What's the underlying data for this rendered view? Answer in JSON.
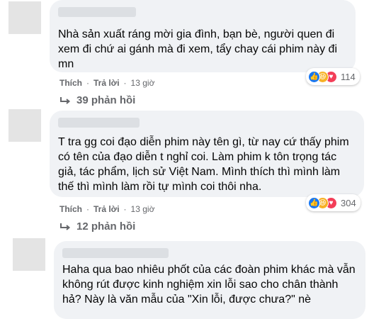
{
  "comments": [
    {
      "text": "Nhà sản xuất ráng mời gia đình, bạn bè, người quen đi xem đi chứ ai gánh mà đi xem, tẩy chay cái phim này đi mn",
      "like_label": "Thích",
      "reply_label": "Trả lời",
      "time": "13 giờ",
      "reaction_count": "114",
      "replies_label": "39 phản hồi"
    },
    {
      "text": "T tra gg coi đạo diễn phim này tên gì, từ nay cứ thấy phim có tên của đạo diễn t nghỉ coi. Làm phim k tôn trọng tác giả, tác phẩm, lịch sử Việt Nam. Mình thích thì mình làm thế thì mình làm rồi tự mình coi thôi nha.",
      "like_label": "Thích",
      "reply_label": "Trả lời",
      "time": "13 giờ",
      "reaction_count": "304",
      "replies_label": "12 phản hồi"
    },
    {
      "text": "Haha qua bao nhiêu phốt của các đoàn phim khác mà vẫn không rút được kinh nghiệm xin lỗi sao cho chân thành hả? Này là văn mẫu của \"Xin lỗi, được chưa?\" nè"
    }
  ],
  "colors": {
    "bubble": "#f0f2f5",
    "meta_text": "#65676b",
    "like": "#1877f2",
    "haha": "#f7b125",
    "love": "#f33e58"
  },
  "icons": [
    "like-reaction-icon",
    "haha-reaction-icon",
    "love-reaction-icon",
    "reply-arrow-icon"
  ]
}
